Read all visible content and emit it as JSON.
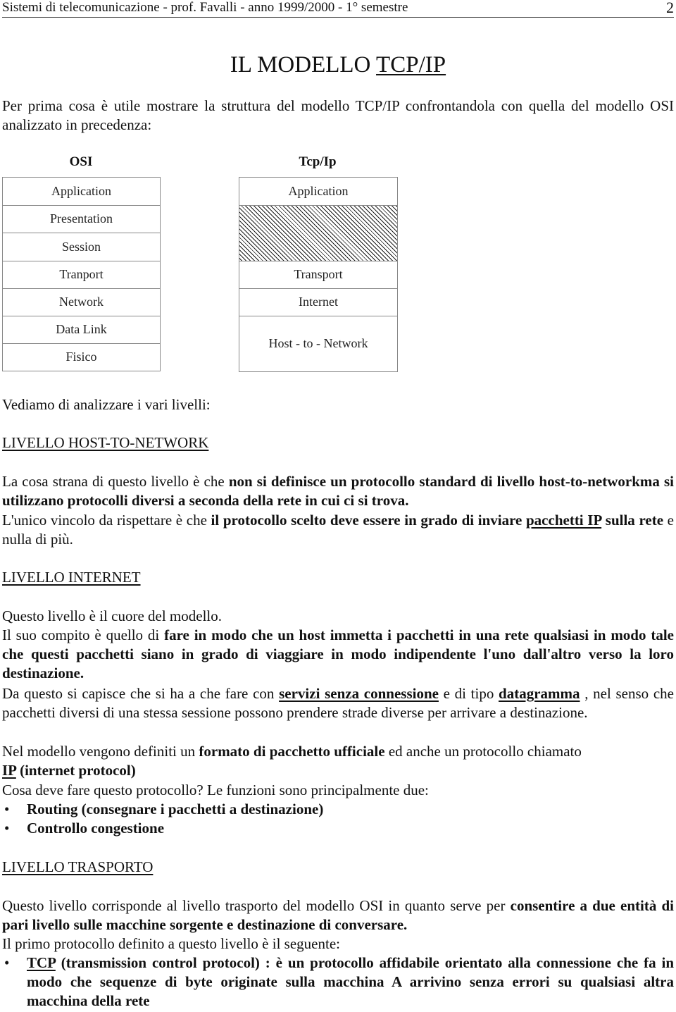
{
  "header": {
    "title": "Sistemi di telecomunicazione - prof. Favalli - anno 1999/2000 - 1° semestre",
    "page_number": "2"
  },
  "page_title": {
    "prefix": "IL MODELLO ",
    "underlined": "TCP/IP"
  },
  "intro": "Per prima cosa è utile mostrare la struttura del modello TCP/IP confrontandola con quella del modello OSI analizzato in precedenza:",
  "diagram": {
    "osi": {
      "title": "OSI",
      "layers": [
        "Application",
        "Presentation",
        "Session",
        "Tranport",
        "Network",
        "Data Link",
        "Fisico"
      ]
    },
    "tcpip": {
      "title": "Tcp/Ip",
      "layers": [
        "Application",
        "",
        "Transport",
        "Internet",
        "Host - to - Network"
      ]
    }
  },
  "lead_in": "Vediamo di analizzare i vari livelli:",
  "sections": {
    "host_to_network": {
      "heading": "LIVELLO HOST-TO-NETWORK",
      "p1_normal": "La cosa strana di questo livello è che ",
      "p1_bold": "non si definisce un protocollo standard di livello host-to-networkma si utilizzano protocolli diversi a seconda della rete in cui ci si trova.",
      "p2_normal": "L'unico vincolo da rispettare è che ",
      "p2_bold": "il protocollo scelto deve essere in grado di inviare ",
      "p2_underlined": "pacchetti IP",
      "p2_bold2": " sulla rete",
      "p2_end": " e nulla di più."
    },
    "internet": {
      "heading": "LIVELLO INTERNET",
      "p1": "Questo livello è il cuore del modello.",
      "p2_normal": "Il suo compito è quello di ",
      "p2_bold": "fare in modo che un host immetta i pacchetti in una rete qualsiasi in modo tale che questi pacchetti siano in grado di viaggiare in modo indipendente l'uno dall'altro verso la loro destinazione.",
      "p3_a": "Da questo si capisce che si ha a che fare con ",
      "p3_u1": "servizi senza connessione",
      "p3_b": " e di tipo ",
      "p3_u2": "datagramma",
      "p3_c": " , nel senso che pacchetti diversi di una stessa sessione possono prendere strade diverse per arrivare a destinazione.",
      "p4_a": "Nel modello vengono definiti un ",
      "p4_bold": "formato di pacchetto ufficiale",
      "p4_b": " ed anche un protocollo chiamato ",
      "p4_u": "IP",
      "p4_bold2": " (internet protocol)",
      "p5": "Cosa deve fare questo protocollo? Le funzioni sono principalmente due:",
      "bullets": [
        "Routing (consegnare i pacchetti a destinazione)",
        "Controllo congestione"
      ]
    },
    "trasporto": {
      "heading": "LIVELLO TRASPORTO",
      "p1_normal": "Questo livello corrisponde al livello trasporto del modello OSI in quanto serve per ",
      "p1_bold": "consentire a due entità di pari livello sulle macchine sorgente e destinazione di conversare.",
      "p2": "Il primo protocollo definito a questo livello è il seguente:",
      "bullet_u": "TCP",
      "bullet_bold": " (transmission control protocol) : è un protocollo affidabile orientato alla connessione che fa in modo che sequenze di byte originate sulla macchina A arrivino senza errori su qualsiasi altra macchina della rete"
    }
  }
}
